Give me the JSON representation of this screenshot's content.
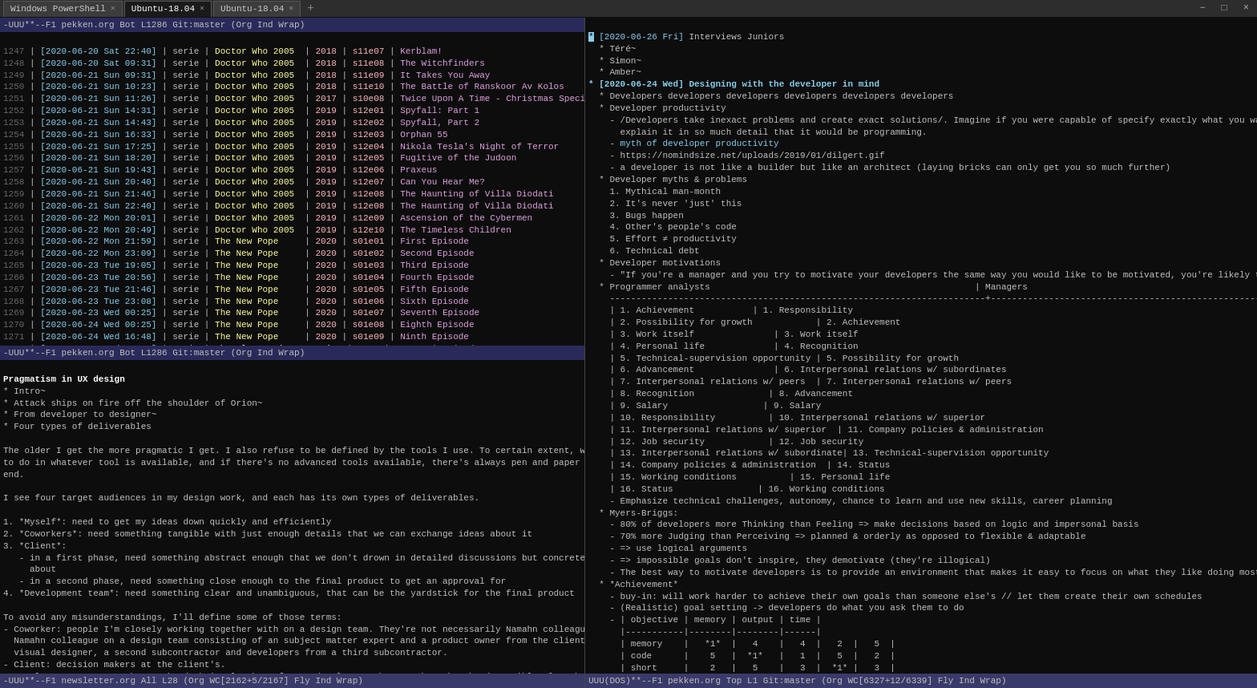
{
  "titlebar": {
    "tabs": [
      {
        "label": "Windows PowerShell",
        "active": false
      },
      {
        "label": "Ubuntu-18.04",
        "active": true
      },
      {
        "label": "Ubuntu-18.04",
        "active": false
      }
    ],
    "new_tab": "+",
    "controls": [
      "−",
      "□",
      "×"
    ]
  },
  "left_pane": {
    "status_top": "-UUU**--F1  pekken.org    Bot L1286 Git:master  (Org Ind Wrap)",
    "status_bottom": "-UUU**--F1  newsletter.org   All L28   (Org WC[2162+5/2167] Fly Ind Wrap)",
    "content_visible": true
  },
  "right_pane": {
    "status_top": "UUU(DOS)**--F1  pekken.org    Top L1  Git:master  (Org WC[6327+12/6339] Fly Ind Wrap)",
    "content_visible": true
  },
  "colors": {
    "bg": "#0d0d0d",
    "fg": "#c0c0c0",
    "accent": "#87ceeb",
    "status_bg": "#2a2a5a"
  }
}
